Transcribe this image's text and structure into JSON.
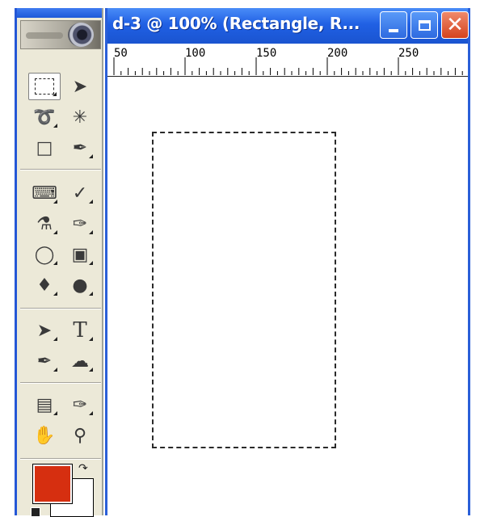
{
  "window": {
    "title": "d-3 @ 100% (Rectangle, R..."
  },
  "ruler": {
    "labels": [
      "50",
      "100",
      "150",
      "200",
      "250"
    ]
  },
  "colors": {
    "foreground": "#d62f10",
    "background": "#ffffff",
    "titlebar": "#2060e4"
  },
  "tools": [
    {
      "name": "rectangular-marquee",
      "icon": "marquee-icon",
      "active": true
    },
    {
      "name": "move",
      "icon": "move-icon"
    },
    {
      "name": "lasso",
      "icon": "lasso-icon"
    },
    {
      "name": "magic-wand",
      "icon": "magic-wand-icon"
    },
    {
      "name": "crop",
      "icon": "crop-icon"
    },
    {
      "name": "slice",
      "icon": "slice-icon"
    },
    {
      "name": "healing-brush",
      "icon": "bandage-icon"
    },
    {
      "name": "brush",
      "icon": "brush-icon"
    },
    {
      "name": "clone-stamp",
      "icon": "stamp-icon"
    },
    {
      "name": "history-brush",
      "icon": "history-brush-icon"
    },
    {
      "name": "eraser",
      "icon": "eraser-icon"
    },
    {
      "name": "gradient",
      "icon": "gradient-icon"
    },
    {
      "name": "blur",
      "icon": "drop-icon"
    },
    {
      "name": "dodge",
      "icon": "dodge-icon"
    },
    {
      "name": "path-selection",
      "icon": "path-select-icon"
    },
    {
      "name": "type",
      "icon": "type-icon",
      "glyph": "T"
    },
    {
      "name": "pen",
      "icon": "pen-icon"
    },
    {
      "name": "custom-shape",
      "icon": "shape-icon"
    },
    {
      "name": "notes",
      "icon": "notes-icon"
    },
    {
      "name": "eyedropper",
      "icon": "eyedropper-icon"
    },
    {
      "name": "hand",
      "icon": "hand-icon"
    },
    {
      "name": "zoom",
      "icon": "zoom-icon"
    }
  ]
}
